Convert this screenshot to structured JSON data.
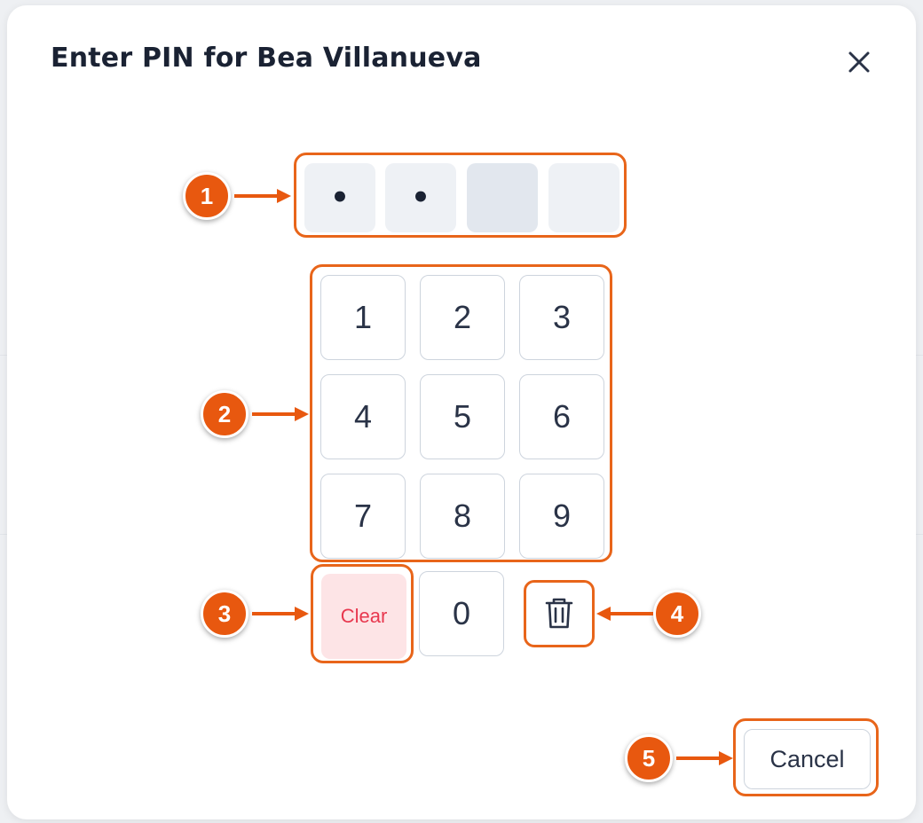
{
  "dialog": {
    "title": "Enter PIN for Bea Villanueva"
  },
  "pin": {
    "slots": [
      "•",
      "•",
      "",
      ""
    ]
  },
  "keypad": {
    "keys": [
      "1",
      "2",
      "3",
      "4",
      "5",
      "6",
      "7",
      "8",
      "9"
    ],
    "zero": "0",
    "clear_label": "Clear"
  },
  "footer": {
    "cancel_label": "Cancel"
  },
  "annotations": [
    "1",
    "2",
    "3",
    "4",
    "5"
  ],
  "colors": {
    "accent": "#e8651a",
    "marker": "#e8580f",
    "clear_bg": "#fde4e6",
    "clear_text": "#e8384f",
    "text": "#1a2233"
  },
  "icons": {
    "close": "close-icon",
    "backspace": "trash-icon"
  }
}
